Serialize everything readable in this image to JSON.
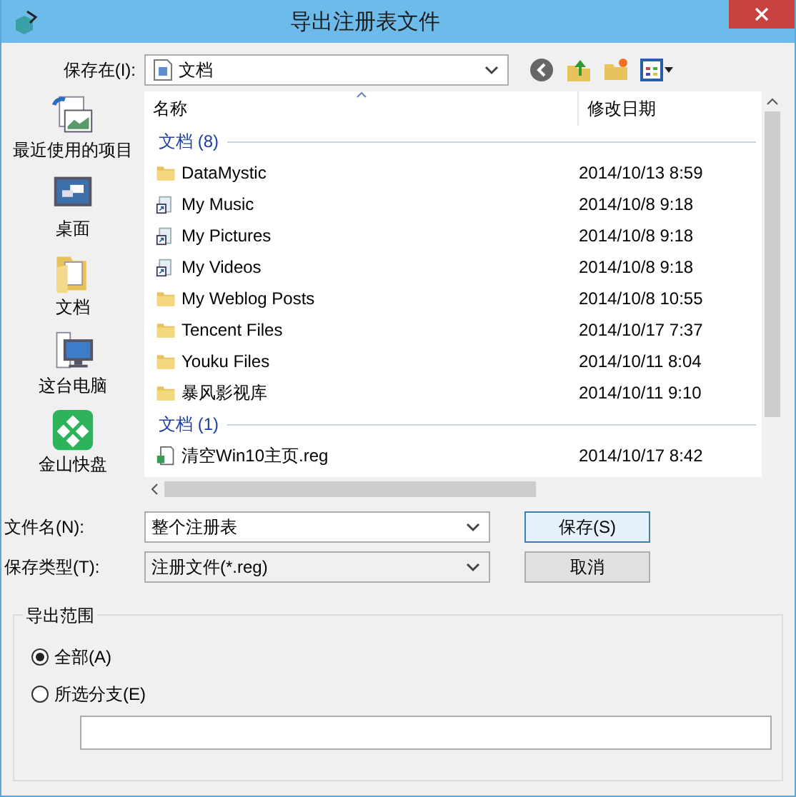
{
  "window": {
    "title": "导出注册表文件"
  },
  "location": {
    "label": "保存在(I):",
    "value": "文档"
  },
  "places": [
    {
      "label": "最近使用的项目",
      "kind": "recent"
    },
    {
      "label": "桌面",
      "kind": "desktop"
    },
    {
      "label": "文档",
      "kind": "documents"
    },
    {
      "label": "这台电脑",
      "kind": "computer"
    },
    {
      "label": "金山快盘",
      "kind": "kuaipan"
    }
  ],
  "file_list": {
    "columns": [
      "名称",
      "修改日期"
    ],
    "groups": [
      {
        "header": "文档 (8)",
        "items": [
          {
            "name": "DataMystic",
            "date": "2014/10/13 8:59",
            "kind": "folder"
          },
          {
            "name": "My Music",
            "date": "2014/10/8 9:18",
            "kind": "shortcut"
          },
          {
            "name": "My Pictures",
            "date": "2014/10/8 9:18",
            "kind": "shortcut"
          },
          {
            "name": "My Videos",
            "date": "2014/10/8 9:18",
            "kind": "shortcut"
          },
          {
            "name": "My Weblog Posts",
            "date": "2014/10/8 10:55",
            "kind": "folder"
          },
          {
            "name": "Tencent Files",
            "date": "2014/10/17 7:37",
            "kind": "folder"
          },
          {
            "name": "Youku Files",
            "date": "2014/10/11 8:04",
            "kind": "folder"
          },
          {
            "name": "暴风影视库",
            "date": "2014/10/11 9:10",
            "kind": "folder"
          }
        ]
      },
      {
        "header": "文档 (1)",
        "items": [
          {
            "name": "清空Win10主页.reg",
            "date": "2014/10/17 8:42",
            "kind": "reg"
          }
        ]
      }
    ]
  },
  "filename": {
    "label": "文件名(N):",
    "value": "整个注册表"
  },
  "filetype": {
    "label": "保存类型(T):",
    "value": "注册文件(*.reg)"
  },
  "buttons": [
    "保存(S)",
    "取消"
  ],
  "export_range": {
    "title": "导出范围",
    "options": [
      {
        "label": "全部(A)",
        "selected": true
      },
      {
        "label": "所选分支(E)",
        "selected": false
      }
    ]
  }
}
